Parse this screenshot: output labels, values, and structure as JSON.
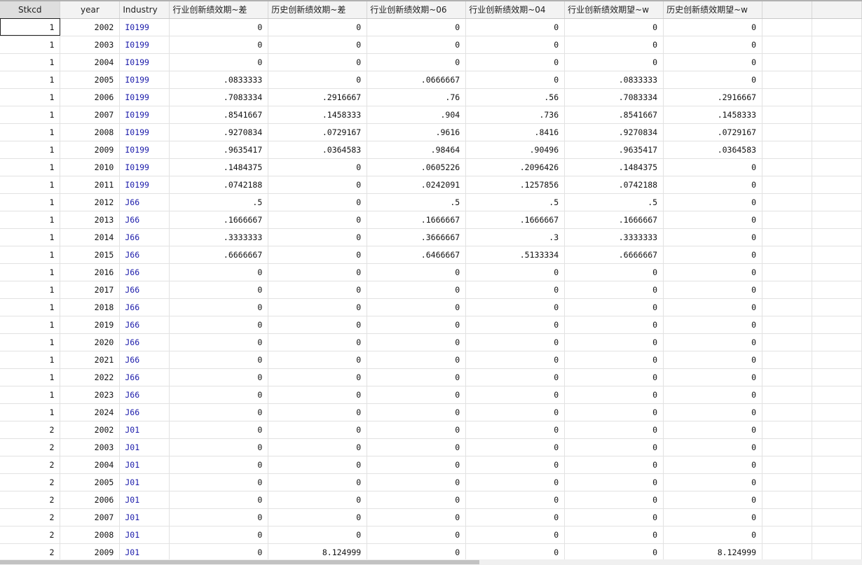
{
  "columns": [
    {
      "key": "stkcd",
      "label": "Stkcd",
      "kind": "num"
    },
    {
      "key": "year",
      "label": "year",
      "kind": "num"
    },
    {
      "key": "industry",
      "label": "Industry",
      "kind": "str"
    },
    {
      "key": "v1",
      "label": "行业创新绩效期~差",
      "kind": "num"
    },
    {
      "key": "v2",
      "label": "历史创新绩效期~差",
      "kind": "num"
    },
    {
      "key": "v3",
      "label": "行业创新绩效期~06",
      "kind": "num"
    },
    {
      "key": "v4",
      "label": "行业创新绩效期~04",
      "kind": "num"
    },
    {
      "key": "v5",
      "label": "行业创新绩效期望~w",
      "kind": "num"
    },
    {
      "key": "v6",
      "label": "历史创新绩效期望~w",
      "kind": "num"
    }
  ],
  "rows": [
    [
      "1",
      "2002",
      "I0199",
      "0",
      "0",
      "0",
      "0",
      "0",
      "0"
    ],
    [
      "1",
      "2003",
      "I0199",
      "0",
      "0",
      "0",
      "0",
      "0",
      "0"
    ],
    [
      "1",
      "2004",
      "I0199",
      "0",
      "0",
      "0",
      "0",
      "0",
      "0"
    ],
    [
      "1",
      "2005",
      "I0199",
      ".0833333",
      "0",
      ".0666667",
      "0",
      ".0833333",
      "0"
    ],
    [
      "1",
      "2006",
      "I0199",
      ".7083334",
      ".2916667",
      ".76",
      ".56",
      ".7083334",
      ".2916667"
    ],
    [
      "1",
      "2007",
      "I0199",
      ".8541667",
      ".1458333",
      ".904",
      ".736",
      ".8541667",
      ".1458333"
    ],
    [
      "1",
      "2008",
      "I0199",
      ".9270834",
      ".0729167",
      ".9616",
      ".8416",
      ".9270834",
      ".0729167"
    ],
    [
      "1",
      "2009",
      "I0199",
      ".9635417",
      ".0364583",
      ".98464",
      ".90496",
      ".9635417",
      ".0364583"
    ],
    [
      "1",
      "2010",
      "I0199",
      ".1484375",
      "0",
      ".0605226",
      ".2096426",
      ".1484375",
      "0"
    ],
    [
      "1",
      "2011",
      "I0199",
      ".0742188",
      "0",
      ".0242091",
      ".1257856",
      ".0742188",
      "0"
    ],
    [
      "1",
      "2012",
      "J66",
      ".5",
      "0",
      ".5",
      ".5",
      ".5",
      "0"
    ],
    [
      "1",
      "2013",
      "J66",
      ".1666667",
      "0",
      ".1666667",
      ".1666667",
      ".1666667",
      "0"
    ],
    [
      "1",
      "2014",
      "J66",
      ".3333333",
      "0",
      ".3666667",
      ".3",
      ".3333333",
      "0"
    ],
    [
      "1",
      "2015",
      "J66",
      ".6666667",
      "0",
      ".6466667",
      ".5133334",
      ".6666667",
      "0"
    ],
    [
      "1",
      "2016",
      "J66",
      "0",
      "0",
      "0",
      "0",
      "0",
      "0"
    ],
    [
      "1",
      "2017",
      "J66",
      "0",
      "0",
      "0",
      "0",
      "0",
      "0"
    ],
    [
      "1",
      "2018",
      "J66",
      "0",
      "0",
      "0",
      "0",
      "0",
      "0"
    ],
    [
      "1",
      "2019",
      "J66",
      "0",
      "0",
      "0",
      "0",
      "0",
      "0"
    ],
    [
      "1",
      "2020",
      "J66",
      "0",
      "0",
      "0",
      "0",
      "0",
      "0"
    ],
    [
      "1",
      "2021",
      "J66",
      "0",
      "0",
      "0",
      "0",
      "0",
      "0"
    ],
    [
      "1",
      "2022",
      "J66",
      "0",
      "0",
      "0",
      "0",
      "0",
      "0"
    ],
    [
      "1",
      "2023",
      "J66",
      "0",
      "0",
      "0",
      "0",
      "0",
      "0"
    ],
    [
      "1",
      "2024",
      "J66",
      "0",
      "0",
      "0",
      "0",
      "0",
      "0"
    ],
    [
      "2",
      "2002",
      "J01",
      "0",
      "0",
      "0",
      "0",
      "0",
      "0"
    ],
    [
      "2",
      "2003",
      "J01",
      "0",
      "0",
      "0",
      "0",
      "0",
      "0"
    ],
    [
      "2",
      "2004",
      "J01",
      "0",
      "0",
      "0",
      "0",
      "0",
      "0"
    ],
    [
      "2",
      "2005",
      "J01",
      "0",
      "0",
      "0",
      "0",
      "0",
      "0"
    ],
    [
      "2",
      "2006",
      "J01",
      "0",
      "0",
      "0",
      "0",
      "0",
      "0"
    ],
    [
      "2",
      "2007",
      "J01",
      "0",
      "0",
      "0",
      "0",
      "0",
      "0"
    ],
    [
      "2",
      "2008",
      "J01",
      "0",
      "0",
      "0",
      "0",
      "0",
      "0"
    ],
    [
      "2",
      "2009",
      "J01",
      "0",
      "8.124999",
      "0",
      "0",
      "0",
      "8.124999"
    ]
  ],
  "active_cell": {
    "row": 0,
    "col": 0
  }
}
